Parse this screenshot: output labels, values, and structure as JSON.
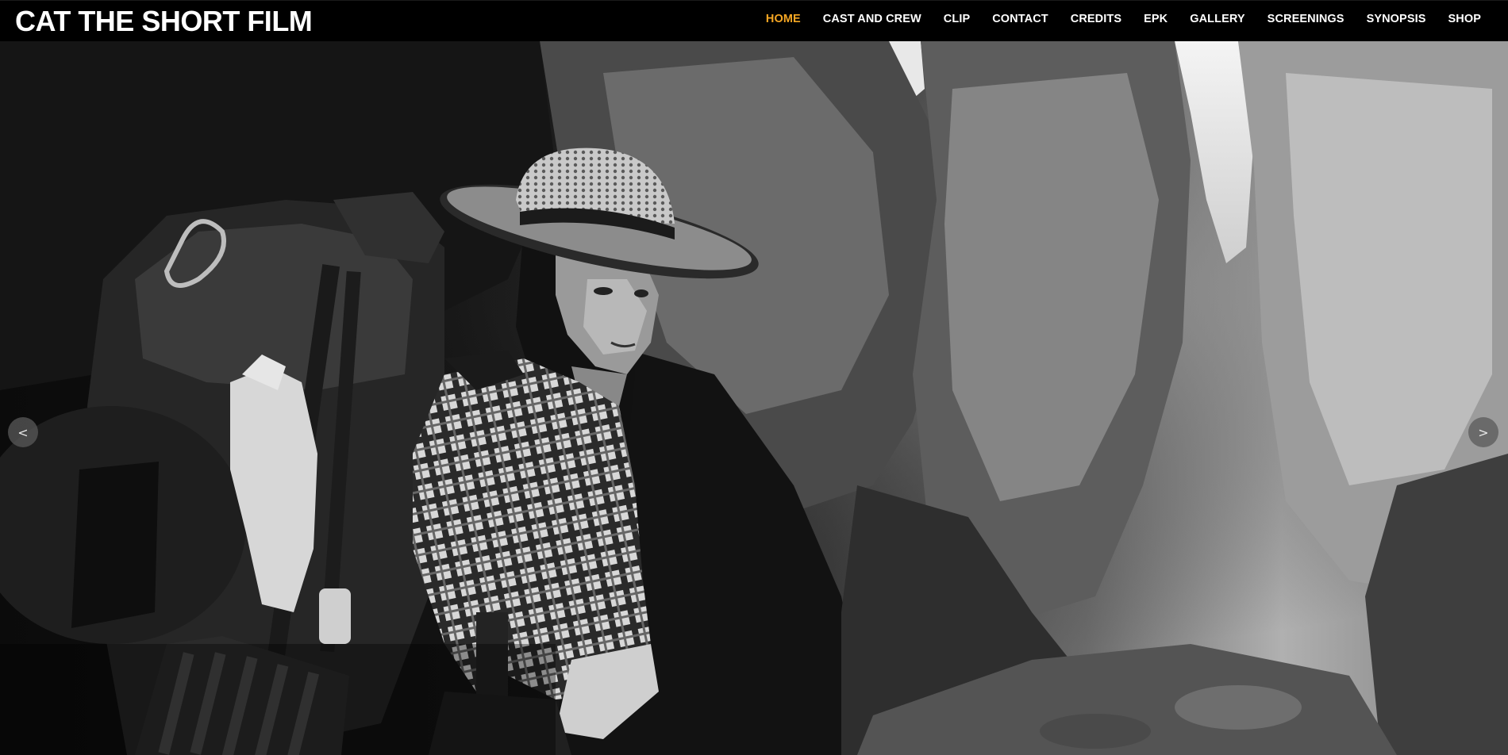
{
  "header": {
    "site_title": "CAT THE SHORT FILM",
    "nav": [
      {
        "label": "HOME",
        "active": true
      },
      {
        "label": "CAST AND CREW",
        "active": false
      },
      {
        "label": "CLIP",
        "active": false
      },
      {
        "label": "CONTACT",
        "active": false
      },
      {
        "label": "CREDITS",
        "active": false
      },
      {
        "label": "EPK",
        "active": false
      },
      {
        "label": "GALLERY",
        "active": false
      },
      {
        "label": "SCREENINGS",
        "active": false
      },
      {
        "label": "SYNOPSIS",
        "active": false
      },
      {
        "label": "SHOP",
        "active": false
      }
    ]
  },
  "slider": {
    "prev_symbol": "<",
    "next_symbol": ">",
    "prev_icon": "chevron-left-icon",
    "next_icon": "chevron-right-icon"
  },
  "colors": {
    "accent": "#f5a623",
    "header_bg": "#000000",
    "nav_text": "#ffffff"
  }
}
